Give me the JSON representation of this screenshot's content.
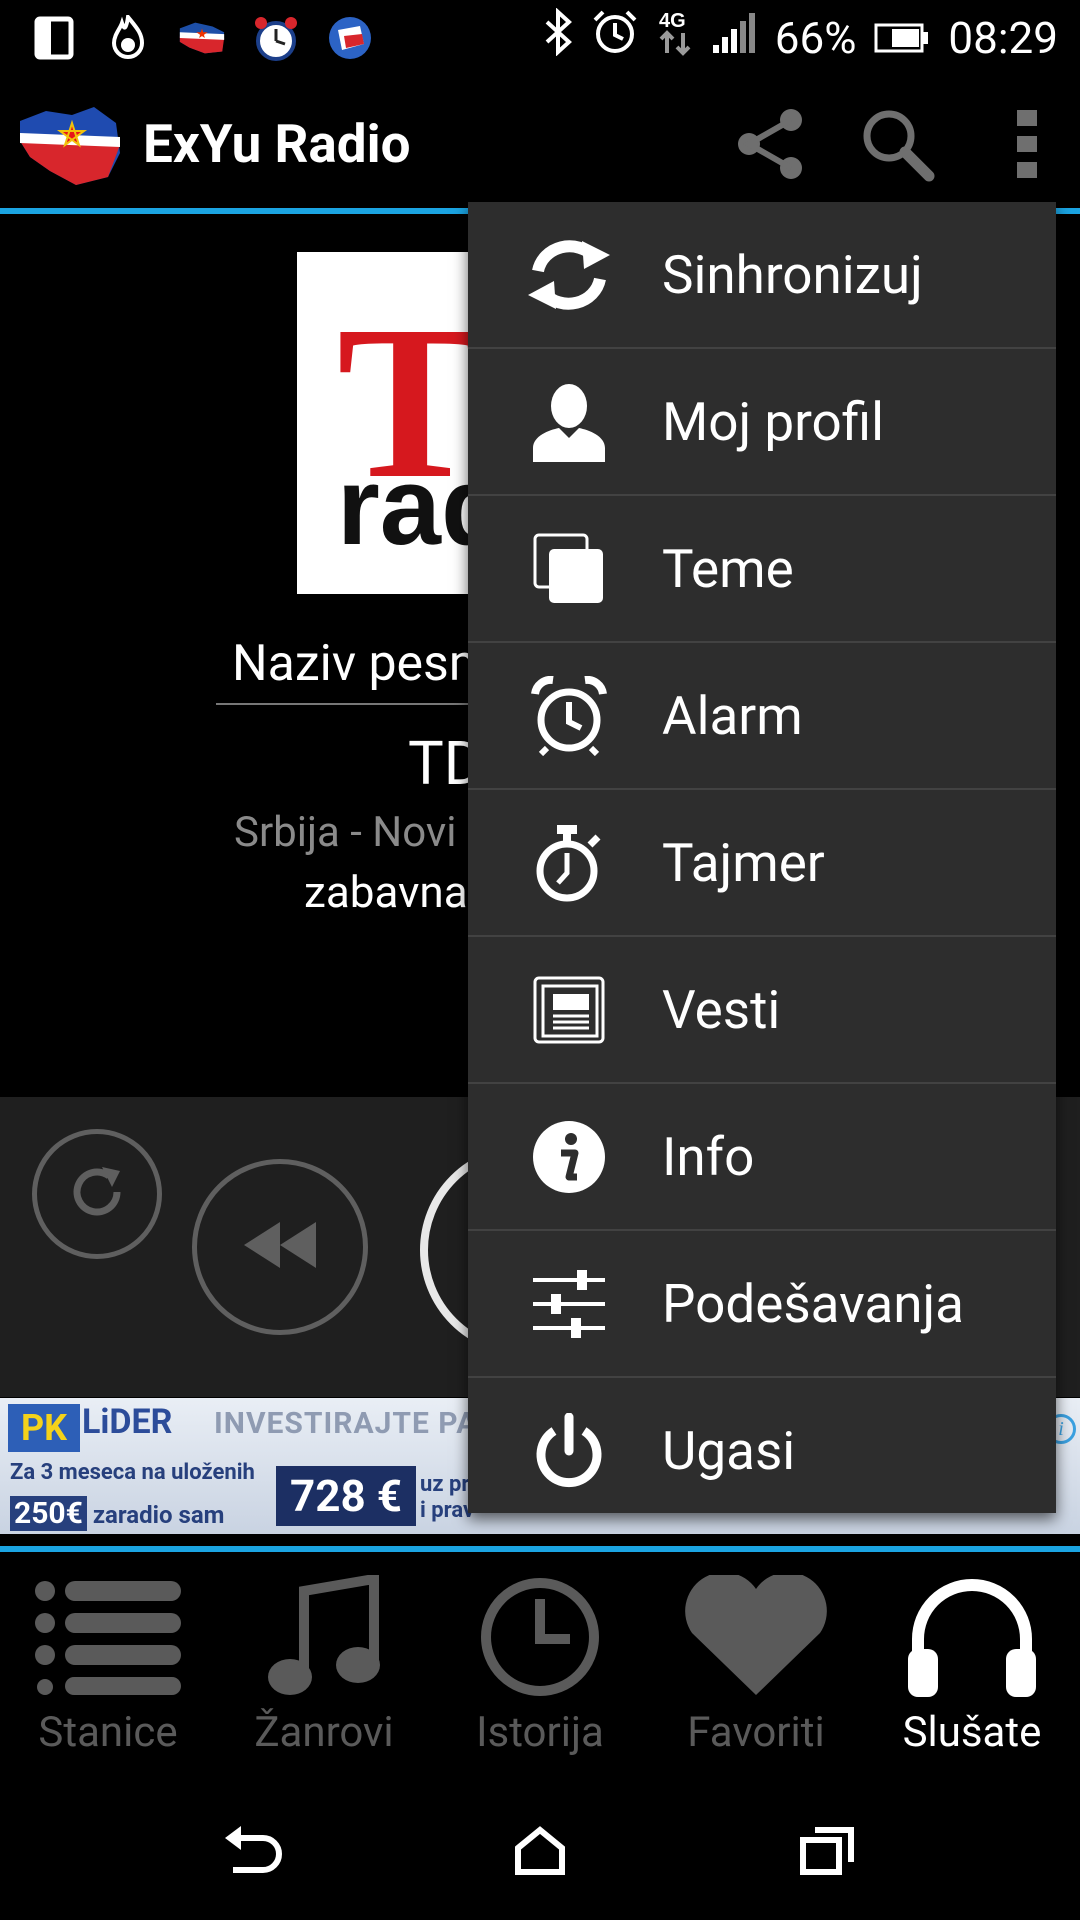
{
  "status_bar": {
    "battery": "66%",
    "time": "08:29",
    "network": "4G",
    "notification_icons": [
      "screen-icon",
      "fire-icon",
      "flag-icon",
      "alarm-clock-app-icon",
      "globe-flag-icon"
    ],
    "system_icons": [
      "bluetooth-icon",
      "alarm-icon",
      "4g-icon",
      "signal-icon",
      "battery-icon"
    ]
  },
  "app_bar": {
    "title": "ExYu Radio",
    "actions": [
      "share-icon",
      "search-icon",
      "overflow-icon"
    ]
  },
  "station": {
    "logo_letter": "T",
    "logo_text": "rad",
    "song_title": "Naziv pesme",
    "name": "TD",
    "location": "Srbija - Novi",
    "genre": "zabavna"
  },
  "ad": {
    "brand": "LiDER",
    "tagline": "INVESTIRAJTE PA",
    "line1": "Za 3 meseca na uloženih",
    "line2_prefix": "250€",
    "line2_suffix": "zaradio sam",
    "amount": "728 €",
    "note1": "uz pr",
    "note2": "i prav"
  },
  "menu": {
    "items": [
      {
        "label": "Sinhronizuj",
        "icon": "sync-icon"
      },
      {
        "label": "Moj profil",
        "icon": "profile-icon"
      },
      {
        "label": "Teme",
        "icon": "themes-icon"
      },
      {
        "label": "Alarm",
        "icon": "alarm-icon"
      },
      {
        "label": "Tajmer",
        "icon": "stopwatch-icon"
      },
      {
        "label": "Vesti",
        "icon": "news-icon"
      },
      {
        "label": "Info",
        "icon": "info-icon"
      },
      {
        "label": "Podešavanja",
        "icon": "sliders-icon"
      },
      {
        "label": "Ugasi",
        "icon": "power-icon"
      }
    ]
  },
  "tabs": {
    "items": [
      {
        "label": "Stanice",
        "icon": "list-icon",
        "active": false
      },
      {
        "label": "Žanrovi",
        "icon": "music-note-icon",
        "active": false
      },
      {
        "label": "Istorija",
        "icon": "clock-icon",
        "active": false
      },
      {
        "label": "Favoriti",
        "icon": "heart-icon",
        "active": false
      },
      {
        "label": "Slušate",
        "icon": "headphones-icon",
        "active": true
      }
    ]
  },
  "navigation": [
    "back-icon",
    "home-icon",
    "recents-icon"
  ],
  "colors": {
    "accent": "#1ba4e2",
    "menu_bg": "#2d2d2d",
    "controls_bg": "#1f1f1f",
    "inactive_tab": "#5a5a5a"
  }
}
